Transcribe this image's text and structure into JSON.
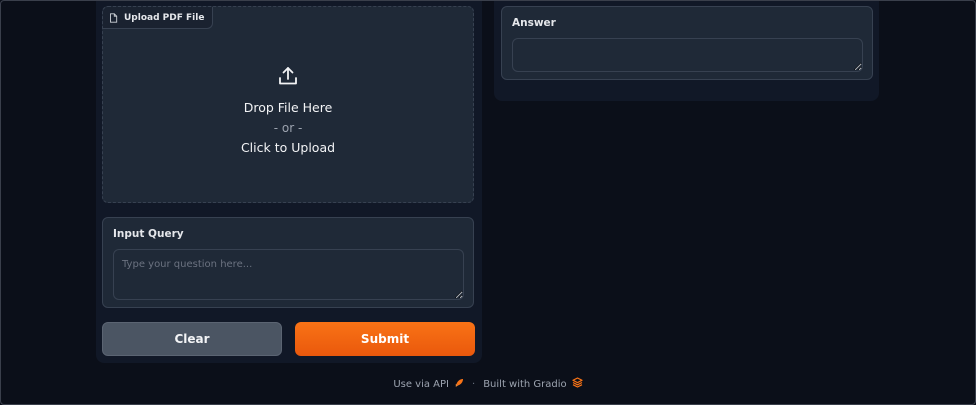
{
  "upload": {
    "label": "Upload PDF File",
    "label_icon": "file-icon",
    "drop_text": "Drop File Here",
    "or_text": "- or -",
    "click_text": "Click to Upload",
    "upload_icon": "upload-icon"
  },
  "query": {
    "label": "Input Query",
    "placeholder": "Type your question here...",
    "value": ""
  },
  "buttons": {
    "clear_label": "Clear",
    "submit_label": "Submit"
  },
  "answer": {
    "label": "Answer",
    "value": ""
  },
  "footer": {
    "api_link": "Use via API",
    "api_icon": "rocket-icon",
    "separator": "·",
    "built_with": "Built with Gradio",
    "gradio_icon": "gradio-logo-icon"
  },
  "colors": {
    "background": "#0b0f19",
    "panel": "#111827",
    "block": "#1f2937",
    "accent": "#f97316",
    "secondary_button": "#4b5563"
  }
}
